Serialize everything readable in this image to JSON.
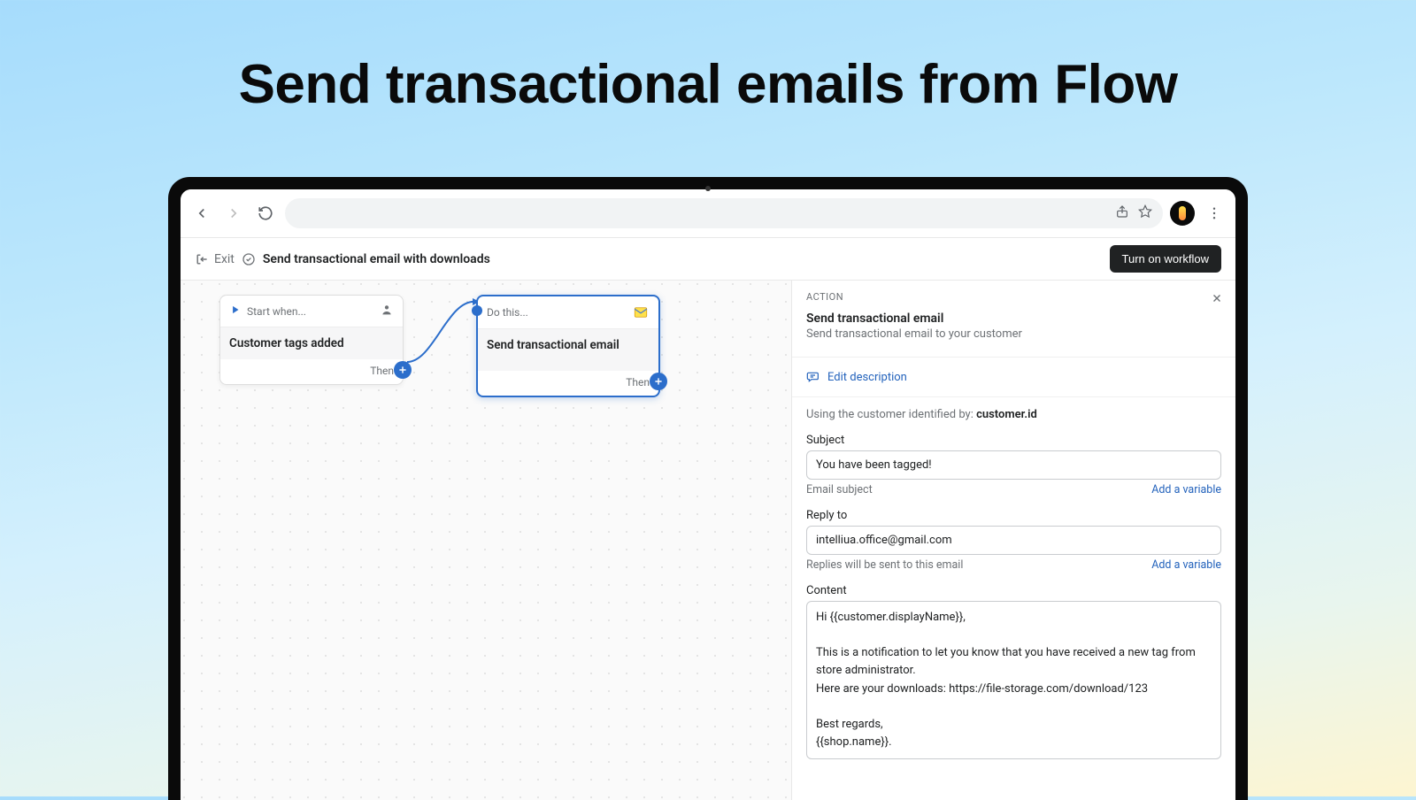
{
  "hero": {
    "title": "Send transactional emails from Flow"
  },
  "appbar": {
    "exit": "Exit",
    "workflow_title": "Send transactional email with downloads",
    "turn_on": "Turn on workflow"
  },
  "canvas": {
    "node_trigger": {
      "head": "Start when...",
      "body": "Customer tags added",
      "then": "Then"
    },
    "node_action": {
      "head": "Do this...",
      "body": "Send transactional email",
      "then": "Then"
    }
  },
  "panel": {
    "caption": "ACTION",
    "title": "Send transactional email",
    "subtitle": "Send transactional email to your customer",
    "edit_description": "Edit description",
    "identified_prefix": "Using the customer identified by: ",
    "identified_value": "customer.id",
    "subject": {
      "label": "Subject",
      "value": "You have been tagged!",
      "help": "Email subject",
      "add_var": "Add a variable"
    },
    "reply_to": {
      "label": "Reply to",
      "value": "intelliua.office@gmail.com",
      "help": "Replies will be sent to this email",
      "add_var": "Add a variable"
    },
    "content": {
      "label": "Content",
      "value": "Hi {{customer.displayName}},\n\nThis is a notification to let you know that you have received a new tag from store administrator.\nHere are your downloads: https://file-storage.com/download/123\n\nBest regards,\n{{shop.name}}."
    }
  }
}
